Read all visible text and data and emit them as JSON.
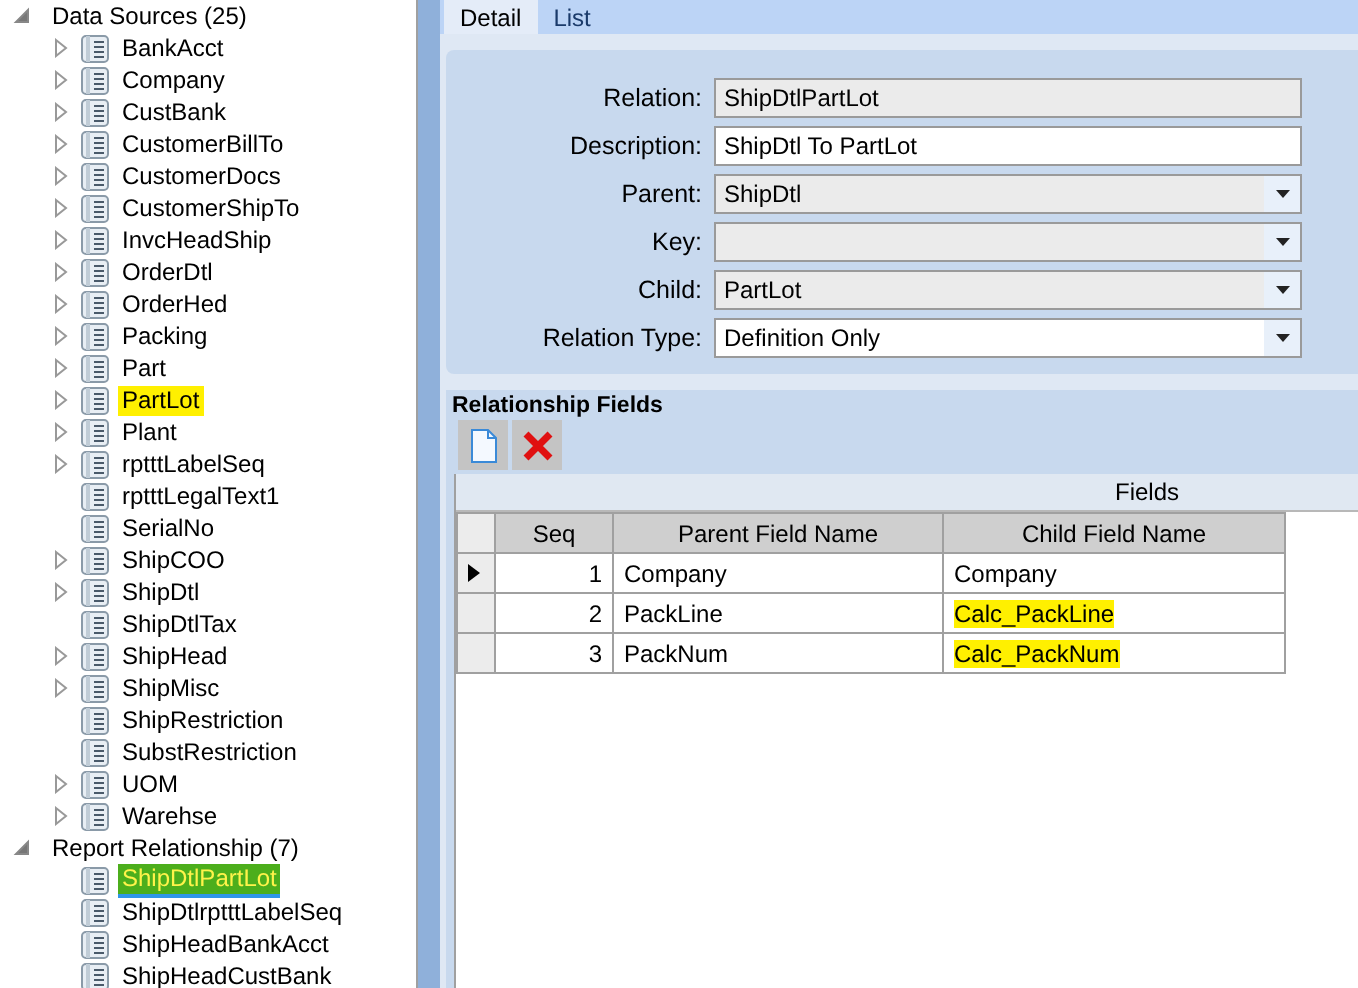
{
  "tree": [
    {
      "label": "Data Sources (25)",
      "expanded": true,
      "children": [
        {
          "label": "BankAcct",
          "expandable": true,
          "highlighted": false,
          "selected": false
        },
        {
          "label": "Company",
          "expandable": true,
          "highlighted": false,
          "selected": false
        },
        {
          "label": "CustBank",
          "expandable": true,
          "highlighted": false,
          "selected": false
        },
        {
          "label": "CustomerBillTo",
          "expandable": true,
          "highlighted": false,
          "selected": false
        },
        {
          "label": "CustomerDocs",
          "expandable": true,
          "highlighted": false,
          "selected": false
        },
        {
          "label": "CustomerShipTo",
          "expandable": true,
          "highlighted": false,
          "selected": false
        },
        {
          "label": "InvcHeadShip",
          "expandable": true,
          "highlighted": false,
          "selected": false
        },
        {
          "label": "OrderDtl",
          "expandable": true,
          "highlighted": false,
          "selected": false
        },
        {
          "label": "OrderHed",
          "expandable": true,
          "highlighted": false,
          "selected": false
        },
        {
          "label": "Packing",
          "expandable": true,
          "highlighted": false,
          "selected": false
        },
        {
          "label": "Part",
          "expandable": true,
          "highlighted": false,
          "selected": false
        },
        {
          "label": "PartLot",
          "expandable": true,
          "highlighted": true,
          "selected": false
        },
        {
          "label": "Plant",
          "expandable": true,
          "highlighted": false,
          "selected": false
        },
        {
          "label": "rptttLabelSeq",
          "expandable": true,
          "highlighted": false,
          "selected": false
        },
        {
          "label": "rptttLegalText1",
          "expandable": false,
          "highlighted": false,
          "selected": false
        },
        {
          "label": "SerialNo",
          "expandable": false,
          "highlighted": false,
          "selected": false
        },
        {
          "label": "ShipCOO",
          "expandable": true,
          "highlighted": false,
          "selected": false
        },
        {
          "label": "ShipDtl",
          "expandable": true,
          "highlighted": false,
          "selected": false
        },
        {
          "label": "ShipDtlTax",
          "expandable": false,
          "highlighted": false,
          "selected": false
        },
        {
          "label": "ShipHead",
          "expandable": true,
          "highlighted": false,
          "selected": false
        },
        {
          "label": "ShipMisc",
          "expandable": true,
          "highlighted": false,
          "selected": false
        },
        {
          "label": "ShipRestriction",
          "expandable": false,
          "highlighted": false,
          "selected": false
        },
        {
          "label": "SubstRestriction",
          "expandable": false,
          "highlighted": false,
          "selected": false
        },
        {
          "label": "UOM",
          "expandable": true,
          "highlighted": false,
          "selected": false
        },
        {
          "label": "Warehse",
          "expandable": true,
          "highlighted": false,
          "selected": false
        }
      ]
    },
    {
      "label": "Report Relationship (7)",
      "expanded": true,
      "children": [
        {
          "label": "ShipDtlPartLot",
          "expandable": false,
          "highlighted": true,
          "selected": true
        },
        {
          "label": "ShipDtlrptttLabelSeq",
          "expandable": false,
          "highlighted": false,
          "selected": false
        },
        {
          "label": "ShipHeadBankAcct",
          "expandable": false,
          "highlighted": false,
          "selected": false
        },
        {
          "label": "ShipHeadCustBank",
          "expandable": false,
          "highlighted": false,
          "selected": false
        }
      ]
    }
  ],
  "tabs": [
    {
      "label": "Detail",
      "selected": true
    },
    {
      "label": "List",
      "selected": false
    }
  ],
  "form": [
    {
      "label": "Relation:",
      "kind": "text",
      "readonly": true,
      "value": "ShipDtlPartLot"
    },
    {
      "label": "Description:",
      "kind": "text",
      "readonly": false,
      "value": "ShipDtl To PartLot"
    },
    {
      "label": "Parent:",
      "kind": "combo",
      "readonly": true,
      "value": "ShipDtl"
    },
    {
      "label": "Key:",
      "kind": "combo",
      "readonly": true
    },
    {
      "label": "Child:",
      "kind": "combo",
      "readonly": true,
      "value": "PartLot"
    },
    {
      "label": "Relation Type:",
      "kind": "combo",
      "readonly": false,
      "value": "Definition Only"
    }
  ],
  "relationship_fields": {
    "title": "Relationship Fields",
    "band": "Fields",
    "columns": [
      "Seq",
      "Parent Field Name",
      "Child Field Name"
    ],
    "rows": [
      {
        "seq": "1",
        "parent": "Company",
        "child": "Company",
        "current": true,
        "child_highlighted": false
      },
      {
        "seq": "2",
        "parent": "PackLine",
        "child": "Calc_PackLine",
        "current": false,
        "child_highlighted": true
      },
      {
        "seq": "3",
        "parent": "PackNum",
        "child": "Calc_PackNum",
        "current": false,
        "child_highlighted": true
      }
    ]
  }
}
